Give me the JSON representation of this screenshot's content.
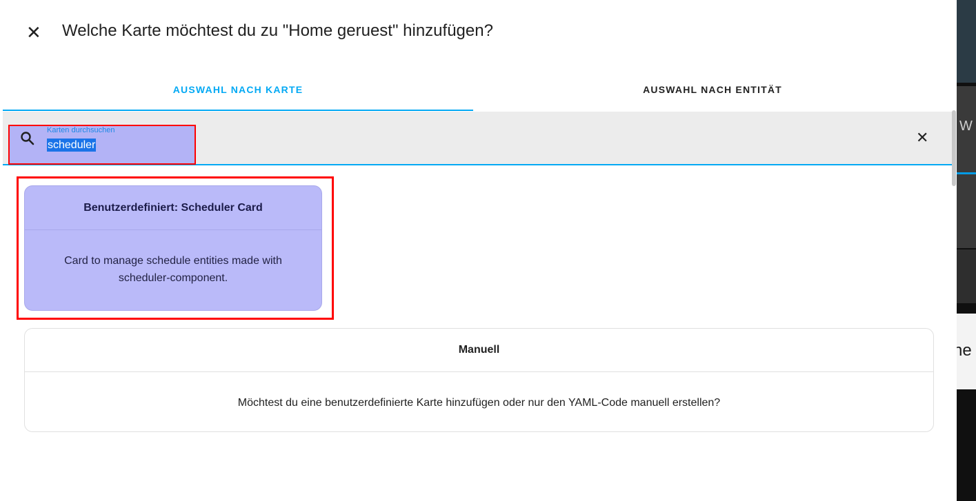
{
  "dialog": {
    "title": "Welche Karte möchtest du zu \"Home geruest\" hinzufügen?",
    "close_icon": "close-icon"
  },
  "tabs": [
    {
      "label": "AUSWAHL NACH KARTE",
      "active": true
    },
    {
      "label": "AUSWAHL NACH ENTITÄT",
      "active": false
    }
  ],
  "search": {
    "label": "Karten durchsuchen",
    "value": "scheduler",
    "icon": "search-icon",
    "clear_icon": "close-icon"
  },
  "cards": [
    {
      "title": "Benutzerdefiniert: Scheduler Card",
      "description": "Card to manage schedule entities made with scheduler-component."
    }
  ],
  "manual": {
    "title": "Manuell",
    "description": "Möchtest du eine benutzerdefinierte Karte hinzufügen oder nur den YAML-Code manuell erstellen?"
  },
  "background": {
    "fragment_1": "W",
    "fragment_2": "ne"
  },
  "colors": {
    "accent": "#03a9f4",
    "highlight": "#ff0000",
    "selection": "#b3b3f6"
  }
}
